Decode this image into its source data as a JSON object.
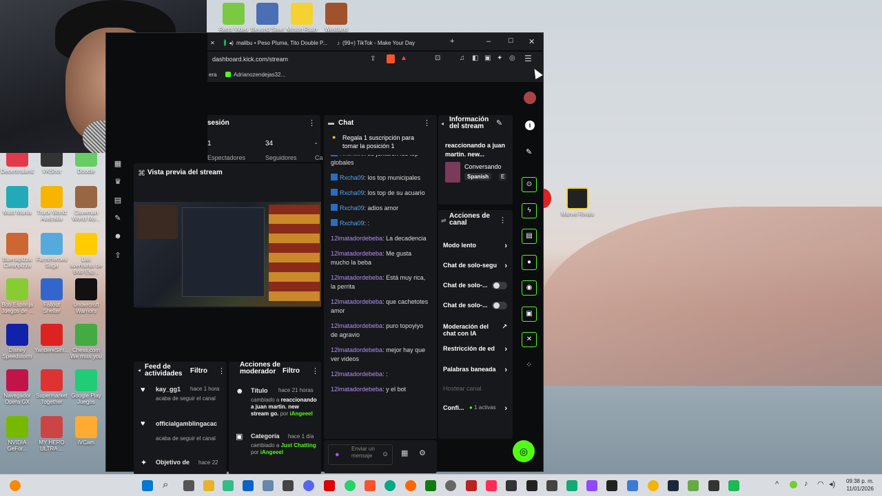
{
  "desktop": {
    "top_icons": [
      {
        "label": "Retro Video",
        "color": "#7ac943"
      },
      {
        "label": "Beyond Steel",
        "color": "#4b6fb5"
      },
      {
        "label": "Minion Rush",
        "color": "#f5d132"
      },
      {
        "label": "Westland",
        "color": "#a0522d"
      }
    ],
    "left_icons": [
      {
        "label": "Decentraland",
        "color": "#e23a4b"
      },
      {
        "label": "VKShot",
        "color": "#333"
      },
      {
        "label": "Doodle",
        "color": "#6c6"
      },
      {
        "label": "Multi Mania",
        "color": "#2ab"
      },
      {
        "label": "Truck World Australia",
        "color": "#f7b500"
      },
      {
        "label": "Caveman World Mo...",
        "color": "#964"
      },
      {
        "label": "Buenapizza Cleanpizza",
        "color": "#c63"
      },
      {
        "label": "FarmHeroes Saga",
        "color": "#5ad"
      },
      {
        "label": "Las aventuras de Bob Esp...",
        "color": "#fc0"
      },
      {
        "label": "Bob Esponja Juegos de ...",
        "color": "#8c3"
      },
      {
        "label": "Fallout Shelter",
        "color": "#36c"
      },
      {
        "label": "Undercroft Warriors",
        "color": "#111"
      },
      {
        "label": "Disney Speedstorm",
        "color": "#12a"
      },
      {
        "label": "YandereSim...",
        "color": "#d22"
      },
      {
        "label": "Chess.com We miss you",
        "color": "#4a4"
      },
      {
        "label": "Navegador Opera GX",
        "color": "#c1154a"
      },
      {
        "label": "Supermarket Together",
        "color": "#d33"
      },
      {
        "label": "Google Play Juegos",
        "color": "#2c7"
      },
      {
        "label": "NVIDIA GeFor...",
        "color": "#76b900"
      },
      {
        "label": "MY HERO ULTRA ...",
        "color": "#c44"
      },
      {
        "label": "iVCam",
        "color": "#fa3"
      }
    ],
    "right_icons": [
      {
        "label": "Marvel Rivals",
        "color": "#222"
      }
    ]
  },
  "browser": {
    "tabs": [
      {
        "label": "malibu • Peso Pluma, Tito Double P...",
        "icon": "spotify-icon"
      },
      {
        "label": "(99+) TikTok - Make Your Day",
        "icon": "tiktok-icon"
      }
    ],
    "url": "dashboard.kick.com/stream",
    "bookmarks": [
      "era",
      "Adrianozendejas32..."
    ]
  },
  "dashboard": {
    "session": {
      "title": "sesión",
      "viewers_value": "1",
      "viewers_label": "Espectadores",
      "followers_value": "34",
      "followers_label": "Seguidores",
      "extra_value": "-",
      "extra_label": "Ca",
      "session_label": "Sesión"
    },
    "preview": {
      "title": "Vista previa del stream"
    },
    "activity": {
      "title": "Feed de actividades",
      "filter": "Filtro",
      "items": [
        {
          "user": "kay_gg1",
          "time": "hace 1 hora",
          "desc": "acaba de seguir el canal"
        },
        {
          "user": "officialgamblingacac",
          "time": "",
          "desc": "acaba de seguir el canal"
        },
        {
          "user": "Objetivo de",
          "time": "hace 22",
          "desc": ""
        }
      ]
    },
    "mod_actions": {
      "title": "Acciones de moderador",
      "filter": "Filtro",
      "items": [
        {
          "title": "Título",
          "time": "hace 21 horas",
          "line1": "cambiado a",
          "value": "reaccionando a juan martin. new stream go.",
          "by_word": "por",
          "by": "iAngeeel"
        },
        {
          "title": "Categoría",
          "time": "hace 1 día",
          "line1": "cambiado a",
          "value": "Just Chatting",
          "by_word": "por",
          "by": "iAngeeel"
        }
      ]
    },
    "chat": {
      "title": "Chat",
      "pinned": "Regala 1 suscripción para tomar la posición 1",
      "messages": [
        {
          "user": "Rxcha09",
          "text": "se juntaron los top globales",
          "type": "u1"
        },
        {
          "user": "Rxcha09",
          "text": "los top municipales",
          "type": "u1"
        },
        {
          "user": "Rxcha09",
          "text": "los top de su acuario",
          "type": "u1"
        },
        {
          "user": "Rxcha09",
          "text": "adios amor",
          "type": "u1"
        },
        {
          "user": "Rxcha09",
          "text": ":",
          "type": "u1"
        },
        {
          "user": "12lmatadordebeba",
          "text": "La decadencia",
          "type": "u2"
        },
        {
          "user": "12lmatadordebeba",
          "text": "Me gusta mucho la beba",
          "type": "u2"
        },
        {
          "user": "12lmatadordebeba",
          "text": "Está muy rica, la perrita",
          "type": "u2"
        },
        {
          "user": "12lmatadordebeba",
          "text": "que cachetotes amor",
          "type": "u2"
        },
        {
          "user": "12lmatadordebeba",
          "text": "puro topoyiyo de agravio",
          "type": "u2"
        },
        {
          "user": "12lmatadordebeba",
          "text": "mejor hay que ver videos",
          "type": "u2"
        },
        {
          "user": "12lmatadordebeba",
          "text": ":",
          "type": "u2"
        },
        {
          "user": "12lmatadordebeba",
          "text": "y el bot",
          "type": "u2"
        }
      ],
      "placeholder": "Enviar un mensaje"
    },
    "stream_info": {
      "title": "Información del stream",
      "stream_title": "reaccionando a juan martin. new...",
      "category": "Conversando",
      "language": "Spanish",
      "extra_tag": "E"
    },
    "channel_actions": {
      "title": "Acciones de canal",
      "rows": [
        {
          "label": "Modo lento",
          "kind": "chevron"
        },
        {
          "label": "Chat de solo-segu",
          "kind": "chevron"
        },
        {
          "label": "Chat de solo-...",
          "kind": "toggle"
        },
        {
          "label": "Chat de solo-...",
          "kind": "toggle"
        },
        {
          "label": "Moderación del chat con IA",
          "kind": "external"
        },
        {
          "label": "Restricción de ed",
          "kind": "chevron"
        },
        {
          "label": "Palabras baneada",
          "kind": "chevron"
        },
        {
          "label": "Hostear canal",
          "kind": "disabled"
        },
        {
          "label": "Confi...",
          "kind": "chevron",
          "badge": "1 activas"
        }
      ]
    }
  },
  "taskbar": {
    "time": "09:38 p. m.",
    "date": "11/01/2026"
  },
  "colors": {
    "kick_green": "#53fc18",
    "panel": "#17181b",
    "bg": "#0b0c0e"
  }
}
